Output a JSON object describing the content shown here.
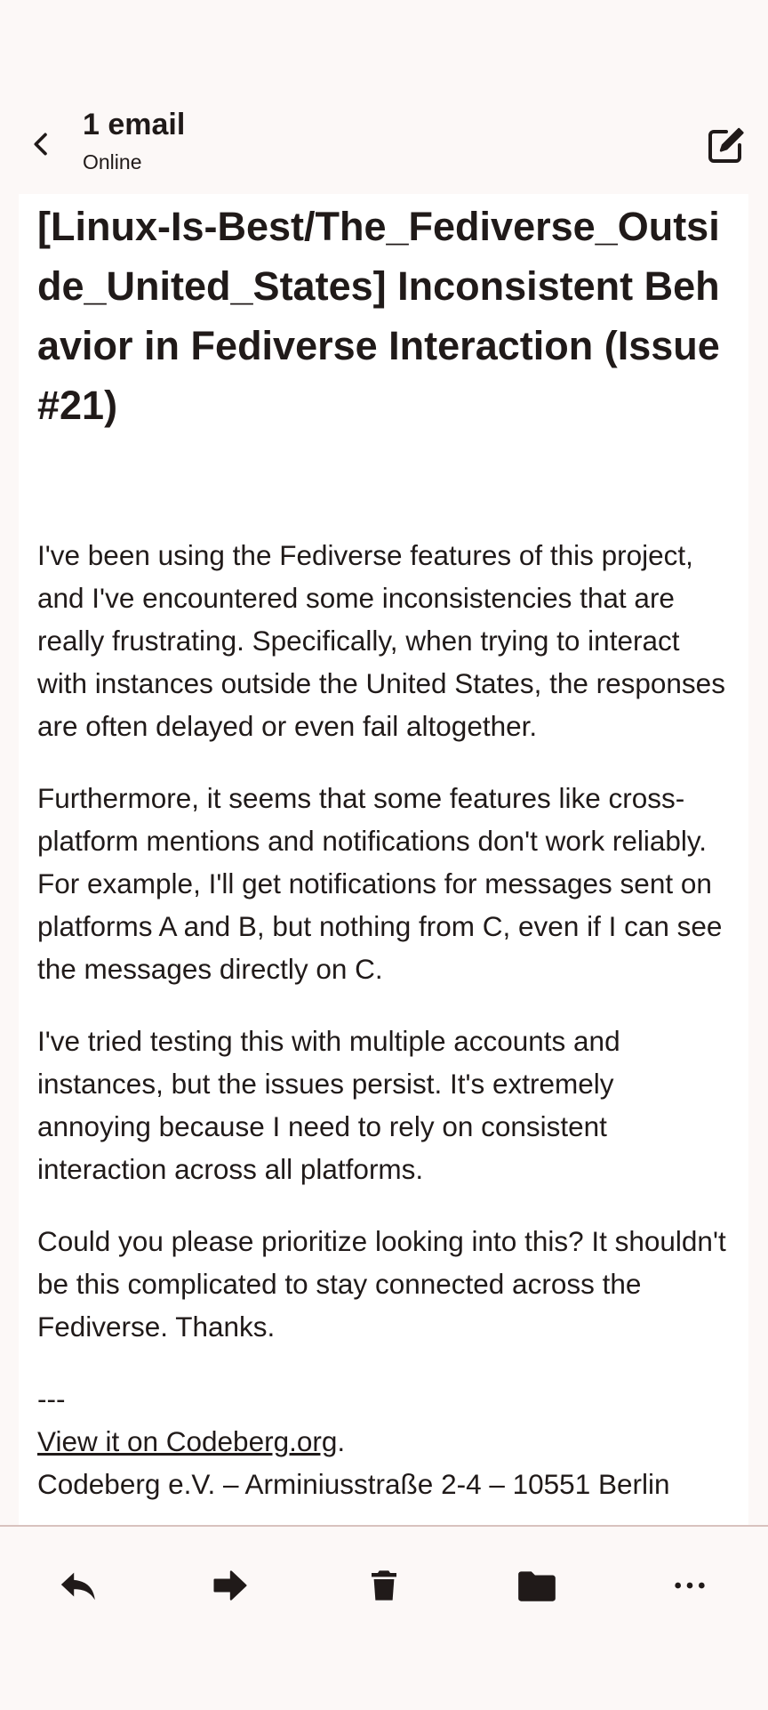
{
  "header": {
    "title": "1 email",
    "status": "Online",
    "back_icon": "chevron-left-icon",
    "compose_icon": "edit-icon"
  },
  "email": {
    "subject": "[Linux-Is-Best/The_Fediverse_Outside_United_States] Inconsistent Behavior in Fediverse Interaction (Issue #21)",
    "paragraphs": [
      "I've been using the Fediverse features of this project, and I've encountered some inconsistencies that are really frustrating. Specifically, when trying to interact with instances outside the United States, the responses are often delayed or even fail altogether.",
      "Furthermore, it seems that some features like cross-platform mentions and notifications don't work reliably. For example, I'll get notifications for messages sent on platforms A and B, but nothing from C, even if I can see the messages directly on C.",
      "I've tried testing this with multiple accounts and instances, but the issues persist. It's extremely annoying because I need to rely on consistent interaction across all platforms.",
      "Could you please prioritize looking into this? It shouldn't be this complicated to stay connected across the Fediverse. Thanks."
    ],
    "signature_separator": "---",
    "view_link": "View it on Codeberg.org",
    "view_link_suffix": ".",
    "footer": "Codeberg e.V. – Arminiusstraße 2-4 – 10551 Berlin"
  },
  "toolbar": {
    "reply_icon": "reply-icon",
    "forward_icon": "forward-icon",
    "delete_icon": "trash-icon",
    "move_icon": "folder-icon",
    "more_icon": "more-horizontal-icon"
  },
  "colors": {
    "background": "#fcf8f7",
    "text": "#201a19",
    "card": "#ffffff",
    "divider": "#d8c2be"
  }
}
